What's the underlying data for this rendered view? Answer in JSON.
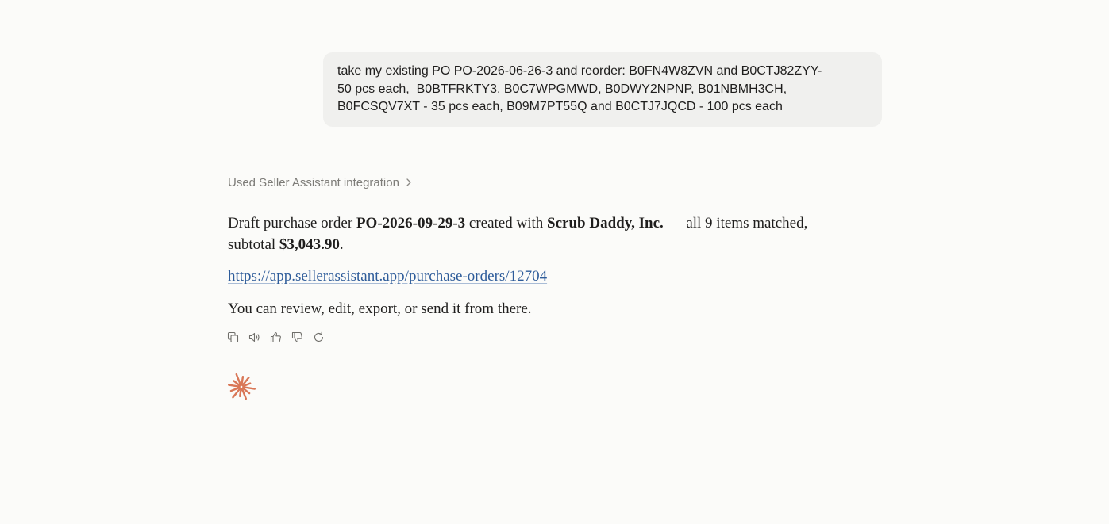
{
  "user_message": {
    "lines": [
      "take my existing PO PO-2026-06-26-3 and reorder: B0FN4W8ZVN and B0CTJ82ZYY-",
      "50 pcs each,  B0BTFRKTY3, B0C7WPGMWD, B0DWY2NPNP, B01NBMH3CH,",
      "B0FCSQV7XT - 35 pcs each, B09M7PT55Q and B0CTJ7JQCD - 100 pcs each"
    ]
  },
  "tool_usage": {
    "label": "Used Seller Assistant integration"
  },
  "assistant_reply": {
    "p1": {
      "t1": "Draft purchase order ",
      "po_number": "PO-2026-09-29-3",
      "t2": " created with ",
      "vendor": "Scrub Daddy, Inc.",
      "t3": " — all 9 items matched,",
      "t4": "subtotal ",
      "subtotal": "$3,043.90",
      "t5": "."
    },
    "link": "https://app.sellerassistant.app/purchase-orders/12704",
    "p3": "You can review, edit, export, or send it from there."
  },
  "actions": [
    "copy-icon",
    "speaker-icon",
    "thumbs-up-icon",
    "thumbs-down-icon",
    "retry-icon"
  ],
  "colors": {
    "background": "#fbfbf9",
    "bubble": "#f0f0ee",
    "link": "#2e5c9a",
    "muted": "#7d7c78",
    "spark": "#d97757"
  }
}
